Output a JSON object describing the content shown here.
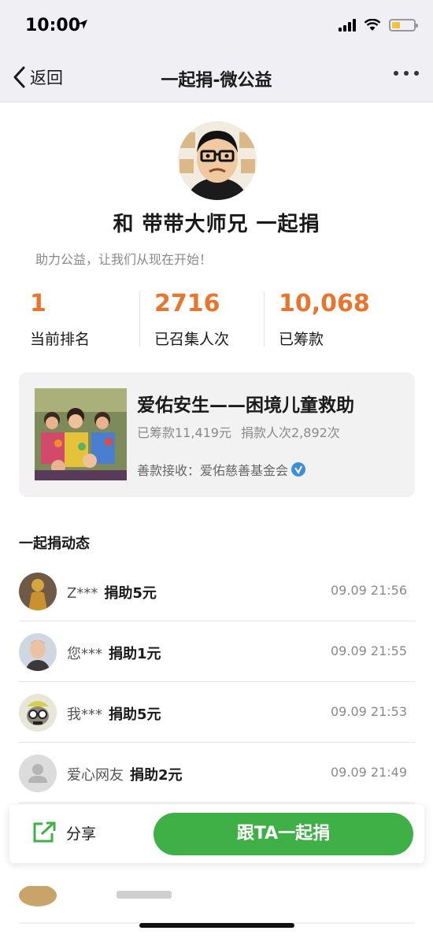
{
  "status": {
    "time": "10:00"
  },
  "nav": {
    "back_label": "返回",
    "title": "一起捐-微公益"
  },
  "profile": {
    "name": "和 带带大师兄 一起捐",
    "slogan": "助力公益，让我们从现在开始！"
  },
  "stats": [
    {
      "value": "1",
      "label": "当前排名"
    },
    {
      "value": "2716",
      "label": "已召集人次"
    },
    {
      "value": "10,068",
      "label": "已筹款"
    }
  ],
  "project": {
    "title": "爱佑安生——困境儿童救助",
    "raised": "已筹款11,419元",
    "donors": "捐款人次2,892次",
    "receiver": "善款接收：爱佑慈善基金会"
  },
  "feed": {
    "title": "一起捐动态",
    "items": [
      {
        "user": "Z***",
        "amount": "捐助5元",
        "time": "09.09 21:56",
        "avatar": "golden-figure-avatar"
      },
      {
        "user": "您***",
        "amount": "捐助1元",
        "time": "09.09 21:55",
        "avatar": "man-portrait-avatar"
      },
      {
        "user": "我***",
        "amount": "捐助5元",
        "time": "09.09 21:53",
        "avatar": "cartoon-skull-avatar"
      },
      {
        "user": "爱心网友",
        "amount": "捐助2元",
        "time": "09.09 21:49",
        "avatar": "default-user-avatar"
      }
    ]
  },
  "actions": {
    "share_label": "分享",
    "join_label": "跟TA一起捐"
  },
  "colors": {
    "accent_orange": "#e8742e",
    "primary_green": "#3fb045",
    "verified_blue": "#3e8fd8"
  }
}
